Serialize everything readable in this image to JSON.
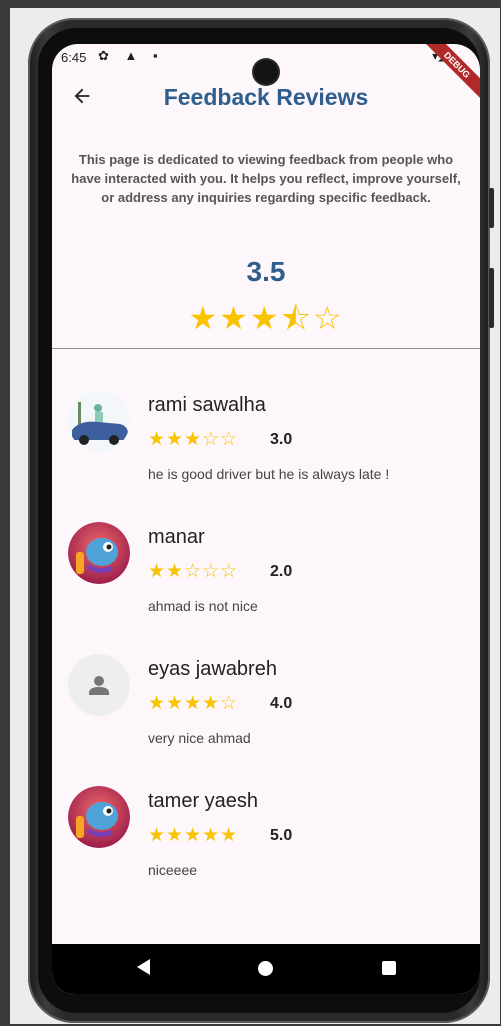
{
  "status": {
    "time": "6:45",
    "icons_left": "✿ ▲ ▪",
    "icons_right": "▾◢▮",
    "debug_label": "DEBUG"
  },
  "appbar": {
    "back_icon": "arrow-back-icon",
    "title": "Feedback Reviews"
  },
  "description": "This page is dedicated to viewing feedback from people who have interacted with you. It helps you reflect, improve yourself, or address any inquiries regarding specific feedback.",
  "summary": {
    "average": "3.5",
    "rating": 3.5,
    "stars": "★★★⯪☆"
  },
  "reviews": [
    {
      "name": "rami sawalha",
      "rating": 3.0,
      "rating_text": "3.0",
      "stars": "★★★☆☆",
      "comment": "he is good driver but he is always late !",
      "avatar": "car-illustration"
    },
    {
      "name": "manar",
      "rating": 2.0,
      "rating_text": "2.0",
      "stars": "★★☆☆☆",
      "comment": "ahmad is not nice",
      "avatar": "chameleon-illustration"
    },
    {
      "name": "eyas jawabreh",
      "rating": 4.0,
      "rating_text": "4.0",
      "stars": "★★★★☆",
      "comment": "very nice ahmad",
      "avatar": "person-placeholder-icon"
    },
    {
      "name": "tamer yaesh",
      "rating": 5.0,
      "rating_text": "5.0",
      "stars": "★★★★★",
      "comment": "niceeee",
      "avatar": "chameleon-illustration"
    }
  ],
  "colors": {
    "accent": "#2f5e8c",
    "star": "#f8c400",
    "background": "#fdf7fb"
  }
}
